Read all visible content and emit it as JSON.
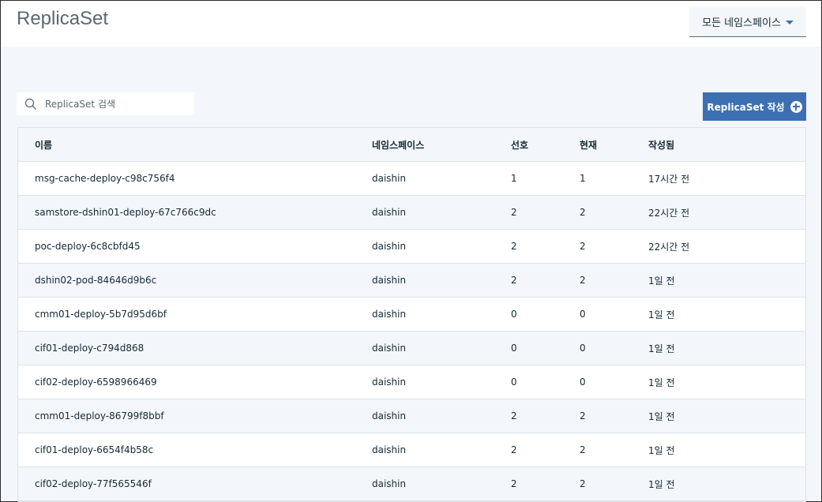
{
  "header": {
    "title": "ReplicaSet",
    "namespace_dropdown": "모든 네임스페이스"
  },
  "toolbar": {
    "search_placeholder": "ReplicaSet 검색",
    "create_button": "ReplicaSet 작성"
  },
  "table": {
    "columns": [
      "이름",
      "네임스페이스",
      "선호",
      "현재",
      "작성됨"
    ],
    "rows": [
      {
        "name": "msg-cache-deploy-c98c756f4",
        "namespace": "daishin",
        "desired": "1",
        "current": "1",
        "created": "17시간 전"
      },
      {
        "name": "samstore-dshin01-deploy-67c766c9dc",
        "namespace": "daishin",
        "desired": "2",
        "current": "2",
        "created": "22시간 전"
      },
      {
        "name": "poc-deploy-6c8cbfd45",
        "namespace": "daishin",
        "desired": "2",
        "current": "2",
        "created": "22시간 전"
      },
      {
        "name": "dshin02-pod-84646d9b6c",
        "namespace": "daishin",
        "desired": "2",
        "current": "2",
        "created": "1일 전"
      },
      {
        "name": "cmm01-deploy-5b7d95d6bf",
        "namespace": "daishin",
        "desired": "0",
        "current": "0",
        "created": "1일 전"
      },
      {
        "name": "cif01-deploy-c794d868",
        "namespace": "daishin",
        "desired": "0",
        "current": "0",
        "created": "1일 전"
      },
      {
        "name": "cif02-deploy-6598966469",
        "namespace": "daishin",
        "desired": "0",
        "current": "0",
        "created": "1일 전"
      },
      {
        "name": "cmm01-deploy-86799f8bbf",
        "namespace": "daishin",
        "desired": "2",
        "current": "2",
        "created": "1일 전"
      },
      {
        "name": "cif01-deploy-6654f4b58c",
        "namespace": "daishin",
        "desired": "2",
        "current": "2",
        "created": "1일 전"
      },
      {
        "name": "cif02-deploy-77f565546f",
        "namespace": "daishin",
        "desired": "2",
        "current": "2",
        "created": "1일 전"
      }
    ]
  },
  "colors": {
    "primary": "#3d70b2",
    "background": "#f3f7fb",
    "text": "#152935"
  }
}
